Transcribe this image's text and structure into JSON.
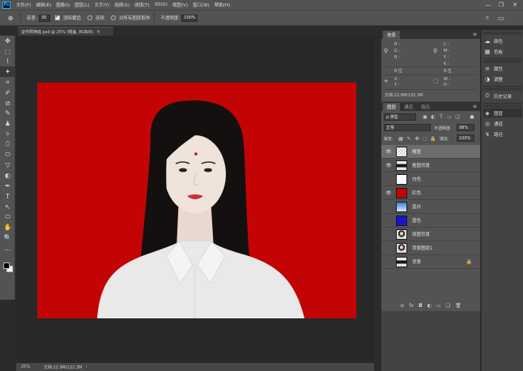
{
  "menubar": {
    "logo": "Ps",
    "items": [
      "文件(F)",
      "编辑(E)",
      "图像(I)",
      "图层(L)",
      "文字(Y)",
      "选择(S)",
      "滤镜(T)",
      "3D(D)",
      "视图(V)",
      "窗口(W)",
      "帮助(H)"
    ],
    "minimize": "—",
    "restore": "❐",
    "close": "✕"
  },
  "options": {
    "tool_icon": "⊕",
    "size_label": "容差:",
    "size_value": "30",
    "antialias_label": "消除锯齿",
    "contiguous_label": "连续",
    "sample_all_label": "对所有图层取样",
    "opacity_label": "不透明度:",
    "opacity_value": "100%",
    "search_icon": "⌕",
    "workspace_icon": "▭"
  },
  "document": {
    "tab_title": "证件照换底.psd @ 25% (帽盖, RGB/8)",
    "close": "✕"
  },
  "toolbar": {
    "tools": [
      "✥",
      "⬚",
      "⌇",
      "✦",
      "⌗",
      "✐",
      "⊘",
      "✎",
      "♟",
      "✧",
      "⬯",
      "⬭",
      "▽",
      "◐",
      "✒",
      "T",
      "↖",
      "⬭",
      "✋",
      "🔍",
      "…"
    ]
  },
  "status": {
    "zoom": "25%",
    "doc_info": "文档:22.9M/122.3M",
    "arrow": "›"
  },
  "info_panel": {
    "tab": "信息",
    "rows": [
      {
        "label": "R :",
        "col": 0,
        "row": 0
      },
      {
        "label": "G :",
        "col": 0,
        "row": 1
      },
      {
        "label": "B :",
        "col": 0,
        "row": 2
      },
      {
        "label": "C :",
        "col": 1,
        "row": 0
      },
      {
        "label": "M :",
        "col": 1,
        "row": 1
      },
      {
        "label": "Y :",
        "col": 1,
        "row": 2
      },
      {
        "label": "K :",
        "col": 1,
        "row": 3
      }
    ],
    "bit_left": "8 位",
    "bit_right": "8 位",
    "x_label": "X :",
    "y_label": "Y :",
    "w_label": "W :",
    "h_label": "H :",
    "doc_text": "文档:22.9M/132.3M"
  },
  "layers_panel": {
    "tabs": [
      "图层",
      "通道",
      "路径"
    ],
    "filter_kind": "ρ 类型",
    "blend_mode": "正常",
    "opacity_label": "不透明度:",
    "opacity_value": "98%",
    "lock_label": "锁定:",
    "fill_label": "填充:",
    "fill_value": "100%",
    "layers": [
      {
        "name": "帽盖",
        "visible": true,
        "thumb": "checker",
        "selected": true,
        "locked": false
      },
      {
        "name": "抠图背景",
        "visible": true,
        "thumb": "portrait",
        "selected": false,
        "locked": false
      },
      {
        "name": "白色",
        "visible": false,
        "thumb": "#ffffff",
        "selected": false,
        "locked": false
      },
      {
        "name": "红色",
        "visible": true,
        "thumb": "#c40404",
        "selected": false,
        "locked": false
      },
      {
        "name": "蓝白",
        "visible": false,
        "thumb": "gradient-blue",
        "selected": false,
        "locked": false
      },
      {
        "name": "蓝色",
        "visible": false,
        "thumb": "#1a14c8",
        "selected": false,
        "locked": false
      },
      {
        "name": "原图背景",
        "visible": false,
        "thumb": "portrait2",
        "selected": false,
        "locked": false
      },
      {
        "name": "背景图层1",
        "visible": false,
        "thumb": "portrait2",
        "selected": false,
        "locked": false
      },
      {
        "name": "背景",
        "visible": false,
        "thumb": "portrait",
        "selected": false,
        "locked": true
      }
    ],
    "bottom_icons": [
      "⊖",
      "fx",
      "◘",
      "◐",
      "▭",
      "❏",
      "🗑"
    ]
  },
  "side_panel": {
    "items": [
      {
        "icon": "☁",
        "label": "颜色"
      },
      {
        "icon": "▦",
        "label": "色板"
      },
      {
        "icon": "≡",
        "label": "属性"
      },
      {
        "icon": "◑",
        "label": "调整"
      },
      {
        "icon": "⏲",
        "label": "历史记录"
      },
      {
        "icon": "◈",
        "label": "图层"
      },
      {
        "icon": "◎",
        "label": "通道"
      },
      {
        "icon": "↯",
        "label": "路径"
      }
    ]
  },
  "colors": {
    "background_red": "#c40404",
    "shirt": "#e9e9e9",
    "hair": "#141010",
    "skin": "#efe3dc"
  }
}
